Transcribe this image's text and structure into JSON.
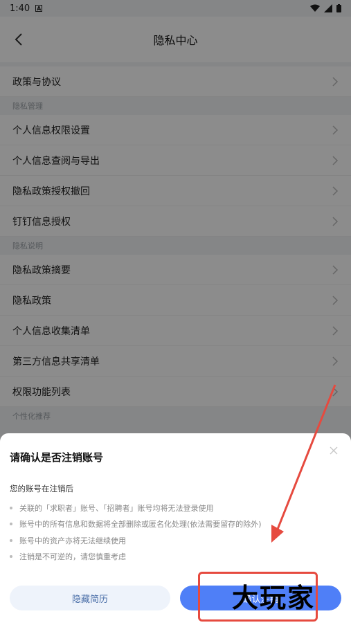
{
  "status": {
    "time": "1:40",
    "app_badge": "A"
  },
  "header": {
    "title": "隐私中心"
  },
  "list": {
    "policy": "政策与协议",
    "section_manage": "隐私管理",
    "manage_items": [
      "个人信息权限设置",
      "个人信息查阅与导出",
      "隐私政策授权撤回",
      "钉钉信息授权"
    ],
    "section_explain": "隐私说明",
    "explain_items": [
      "隐私政策摘要",
      "隐私政策",
      "个人信息收集清单",
      "第三方信息共享清单",
      "权限功能列表"
    ],
    "section_personal": "个性化推荐"
  },
  "dialog": {
    "title": "请确认是否注销账号",
    "subtitle": "您的账号在注销后",
    "bullets": [
      "关联的「求职者」账号、「招聘者」账号均将无法登录使用",
      "账号中的所有信息和数据将全部删除或匿名化处理(依法需要留存的除外)",
      "账号中的资产亦将无法继续使用",
      "注销是不可逆的，请您慎重考虑"
    ],
    "hide_label": "隐藏简历",
    "confirm_label": "确认注销"
  },
  "watermark": "大玩家"
}
